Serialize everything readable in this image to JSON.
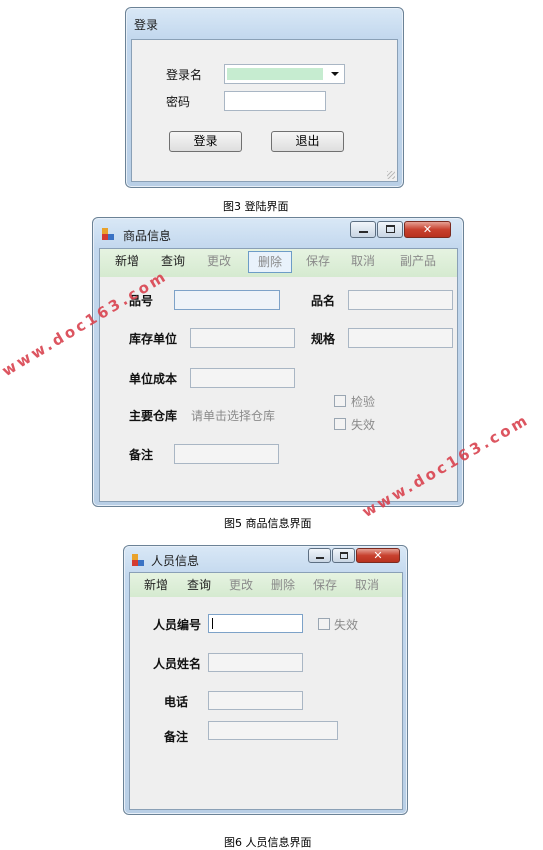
{
  "login": {
    "title": "登录",
    "username_label": "登录名",
    "password_label": "密码",
    "login_button": "登录",
    "exit_button": "退出",
    "caption": "图3   登陆界面"
  },
  "product": {
    "title": "商品信息",
    "toolbar": [
      "新增",
      "查询",
      "更改",
      "删除",
      "保存",
      "取消",
      "副产品"
    ],
    "fields": {
      "code": "品号",
      "name": "品名",
      "stock_unit": "库存单位",
      "spec": "规格",
      "unit_cost": "单位成本",
      "warehouse": "主要仓库",
      "warehouse_hint": "请单击选择仓库",
      "remark": "备注"
    },
    "checkboxes": {
      "inspect": "检验",
      "invalid": "失效"
    },
    "caption": "图5   商品信息界面"
  },
  "person": {
    "title": "人员信息",
    "toolbar": [
      "新增",
      "查询",
      "更改",
      "删除",
      "保存",
      "取消"
    ],
    "fields": {
      "id": "人员编号",
      "name": "人员姓名",
      "phone": "电话",
      "remark": "备注"
    },
    "checkboxes": {
      "invalid": "失效"
    },
    "caption": "图6   人员信息界面"
  },
  "watermark": "www.doc163.com",
  "colors": {
    "close": "#c8412e",
    "toolbar": "#d5ead0",
    "combo_highlight": "#c6ecd0",
    "watermark": "#d9434f"
  }
}
